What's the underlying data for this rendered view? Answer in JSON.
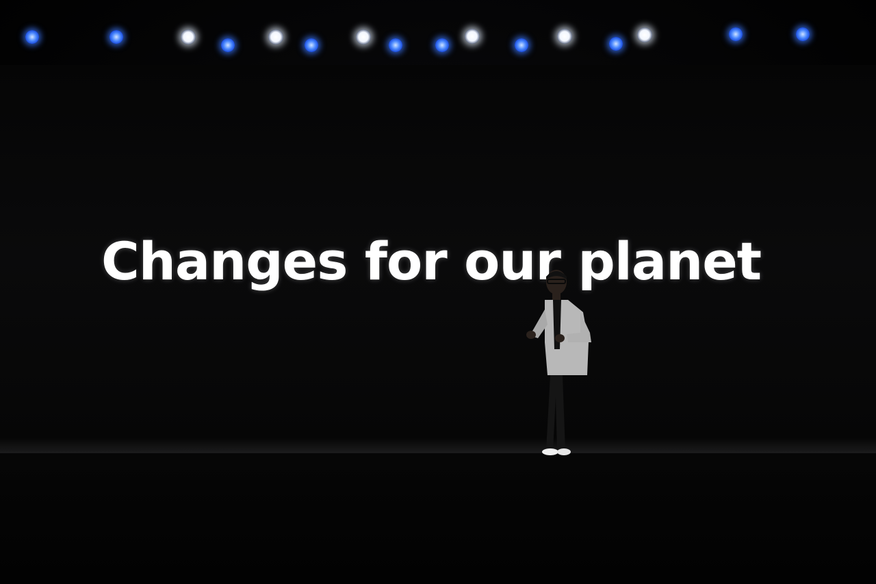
{
  "slide": {
    "headline": "Changes for our planet"
  },
  "colors": {
    "background": "#000000",
    "headline_text": "#ffffff",
    "stage_light_white": "#ffffff",
    "stage_light_blue": "#3c6cff",
    "speaker_jacket": "#b8b8b8"
  },
  "stage_lights": [
    {
      "color": "blue"
    },
    {
      "color": "blue"
    },
    {
      "color": "white"
    },
    {
      "color": "blue"
    },
    {
      "color": "white"
    },
    {
      "color": "blue"
    },
    {
      "color": "white"
    },
    {
      "color": "blue"
    },
    {
      "color": "blue"
    },
    {
      "color": "white"
    },
    {
      "color": "blue"
    },
    {
      "color": "white"
    },
    {
      "color": "blue"
    },
    {
      "color": "white"
    },
    {
      "color": "blue"
    },
    {
      "color": "blue"
    }
  ]
}
